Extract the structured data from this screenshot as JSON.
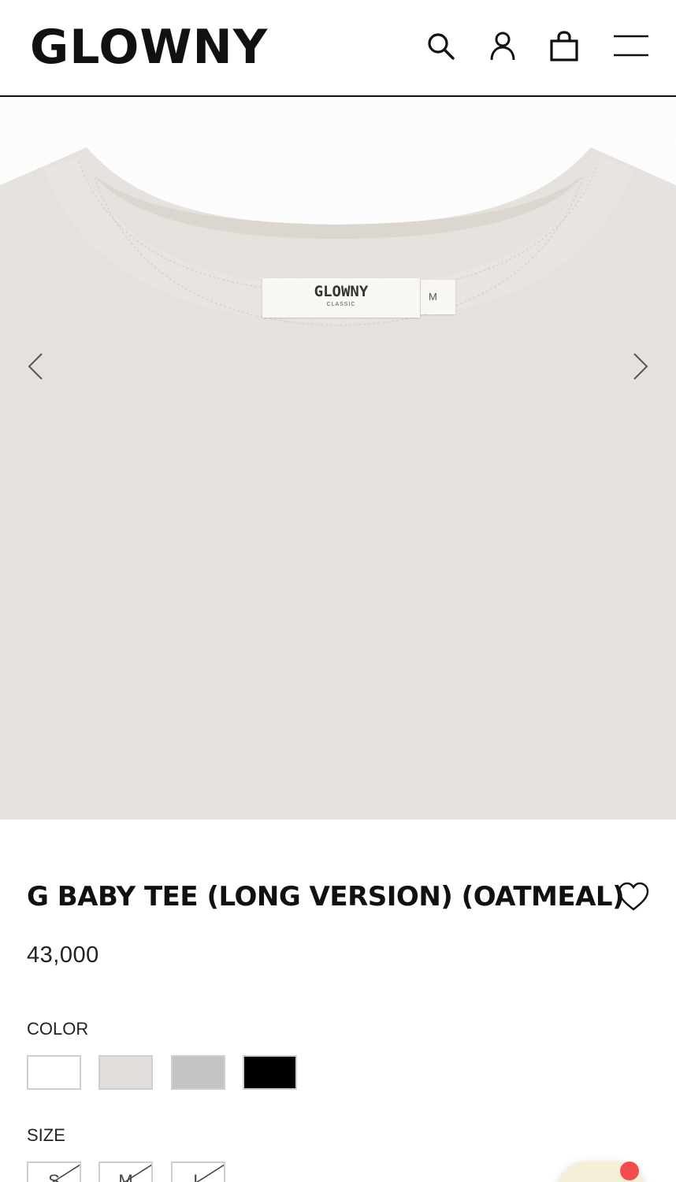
{
  "header": {
    "logo": "GLOWNY",
    "icons": [
      "search-icon",
      "user-icon",
      "shopping-bag-icon",
      "menu-icon"
    ]
  },
  "gallery": {
    "label_brand": "GLOWNY",
    "label_sub": "CLASSIC",
    "label_size": "M",
    "fabric_color": "#e7e3df"
  },
  "product": {
    "title": "G BABY TEE (LONG VERSION) (OATMEAL)",
    "price": "43,000"
  },
  "color_section": {
    "label": "COLOR",
    "swatches": [
      {
        "name": "white",
        "hex": "#ffffff"
      },
      {
        "name": "oatmeal",
        "hex": "#e2dedb"
      },
      {
        "name": "gray",
        "hex": "#c3c3c3"
      },
      {
        "name": "black",
        "hex": "#000000"
      }
    ]
  },
  "size_section": {
    "label": "SIZE",
    "options": [
      "S",
      "M",
      "L"
    ]
  },
  "colors": {
    "accent": "#111111",
    "notification": "#f24d4d",
    "chat_button": "#f5efd8"
  }
}
